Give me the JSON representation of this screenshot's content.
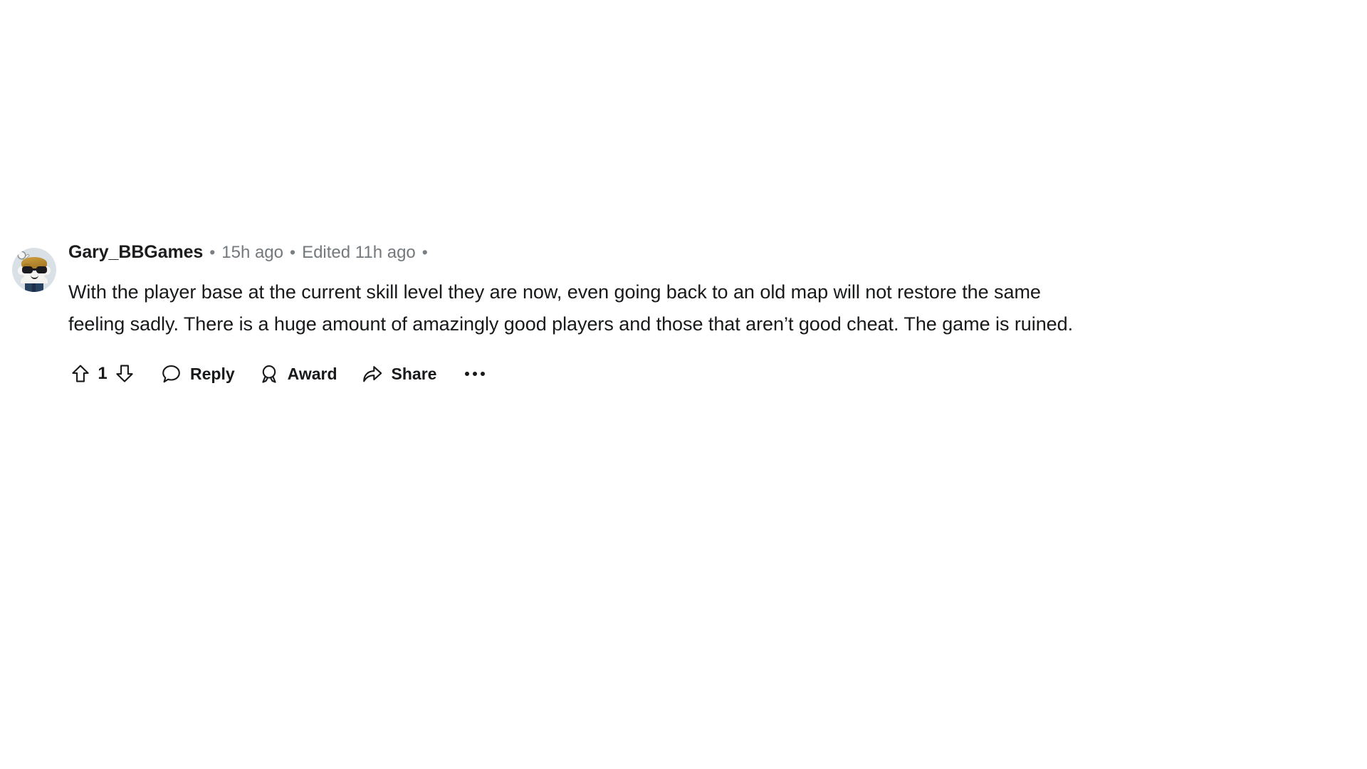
{
  "comment": {
    "author": "Gary_BBGames",
    "separator": "•",
    "timestamp": "15h ago",
    "edited": "Edited 11h ago",
    "trailing_separator": "•",
    "body": "With the player base at the current skill level they are now, even going back to an old map will not restore the same feeling sadly. There is a huge amount of amazingly good players and those that aren’t good cheat. The game is ruined.",
    "avatar": {
      "icon": "snoo-avatar",
      "hair_color": "#b5882f",
      "glasses_color": "#1b1b1f",
      "shirt_color": "#27425e",
      "background_color": "#d9e0e6",
      "face_color": "#f7f5f1"
    },
    "actions": {
      "upvote_icon": "upvote-arrow-icon",
      "vote_count": "1",
      "downvote_icon": "downvote-arrow-icon",
      "reply_icon": "comment-bubble-icon",
      "reply_label": "Reply",
      "award_icon": "award-medal-icon",
      "award_label": "Award",
      "share_icon": "share-arrow-icon",
      "share_label": "Share",
      "overflow_icon": "more-options-icon"
    }
  },
  "theme": {
    "background": "#ffffff",
    "text_primary": "#17191b",
    "text_secondary": "#74797d"
  }
}
